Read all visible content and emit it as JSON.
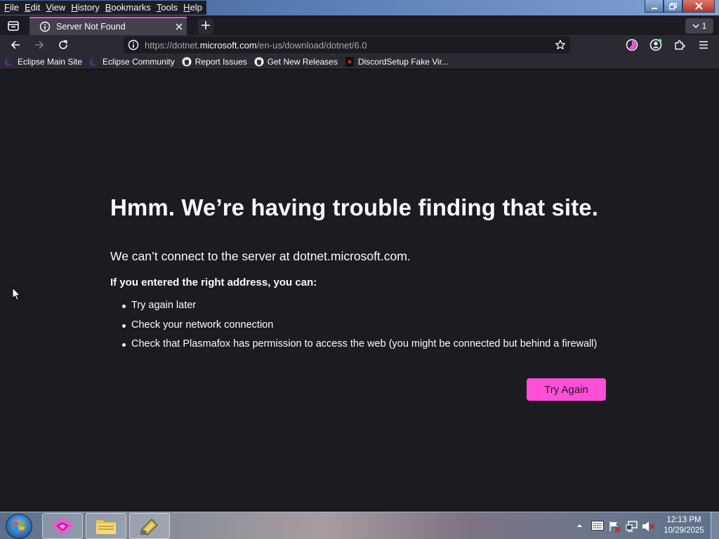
{
  "menu": [
    "File",
    "Edit",
    "View",
    "History",
    "Bookmarks",
    "Tools",
    "Help"
  ],
  "tab": {
    "title": "Server Not Found",
    "count": "1"
  },
  "url": {
    "prefix": "https://dotnet.",
    "host": "microsoft.com",
    "path": "/en-us/download/dotnet/6.0"
  },
  "bookmarks": [
    {
      "label": "Eclipse Main Site",
      "icon": "eclipse-icon"
    },
    {
      "label": "Eclipse Community",
      "icon": "eclipse-icon"
    },
    {
      "label": "Report Issues",
      "icon": "github-icon"
    },
    {
      "label": "Get New Releases",
      "icon": "github-icon"
    },
    {
      "label": "DiscordSetup Fake Vir...",
      "icon": "warning-app-icon"
    }
  ],
  "error": {
    "title": "Hmm. We’re having trouble finding that site.",
    "short": "We can’t connect to the server at dotnet.microsoft.com.",
    "intro": "If you entered the right address, you can:",
    "items": [
      "Try again later",
      "Check your network connection",
      "Check that Plasmafox has permission to access the web (you might be connected but behind a firewall)"
    ],
    "button": "Try Again"
  },
  "clock": {
    "time": "12:13 PM",
    "date": "10/29/2025"
  },
  "colors": {
    "accent": "#ff4fd8",
    "page_bg": "#1c1b22",
    "toolbar_bg": "#2b2a33"
  }
}
